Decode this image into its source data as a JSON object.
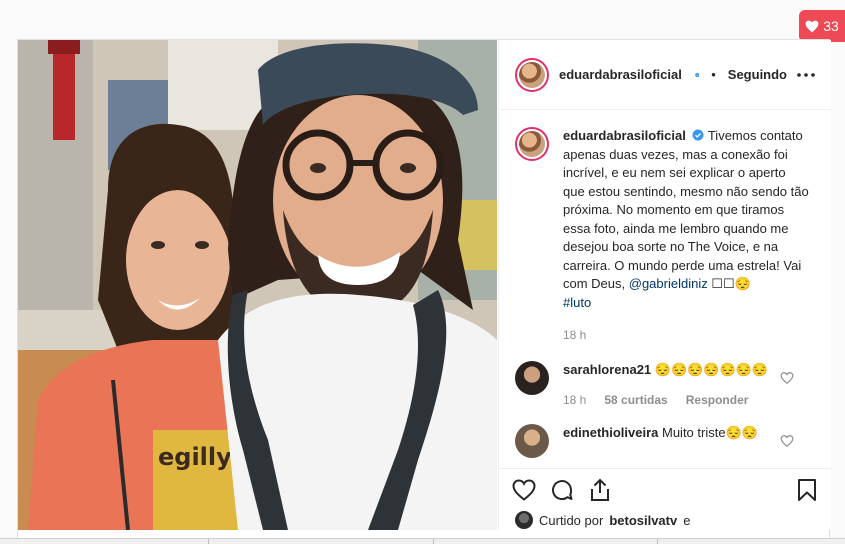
{
  "notification": {
    "count": "33",
    "icon": "heart-icon"
  },
  "post": {
    "username": "eduardabrasiloficial",
    "follow_sep": "•",
    "follow_label": "Seguindo",
    "caption": "Tivemos contato apenas duas vezes, mas a conexão foi incrível, e eu nem sei explicar o aperto que estou sentindo, mesmo não sendo tão próxima. No momento em que tiramos essa foto, ainda me lembro quando me desejou boa sorte no The Voice, e na carreira. O mundo perde uma estrela! Vai com Deus, ",
    "mention": "@gabrieldiniz",
    "caption_tail": " ☐☐😔",
    "hashtag": "#luto",
    "time": "18 h"
  },
  "comments": [
    {
      "username": "sarahlorena21",
      "text": "😔😔😔😔😔😔😔",
      "time": "18 h",
      "likes": "58 curtidas",
      "reply": "Responder"
    },
    {
      "username": "edinethioliveira",
      "text": "Muito triste😔😔"
    }
  ],
  "likes_line": {
    "prefix": "Curtido por",
    "user": "betosilvatv",
    "suffix": "e"
  },
  "colors": {
    "accent": "#e1306c",
    "verified": "#3897f0",
    "link": "#00376b",
    "badge": "#ed4956"
  },
  "icons": [
    "more-options-icon",
    "like-icon",
    "comment-icon",
    "share-icon",
    "save-icon",
    "verified-icon"
  ]
}
